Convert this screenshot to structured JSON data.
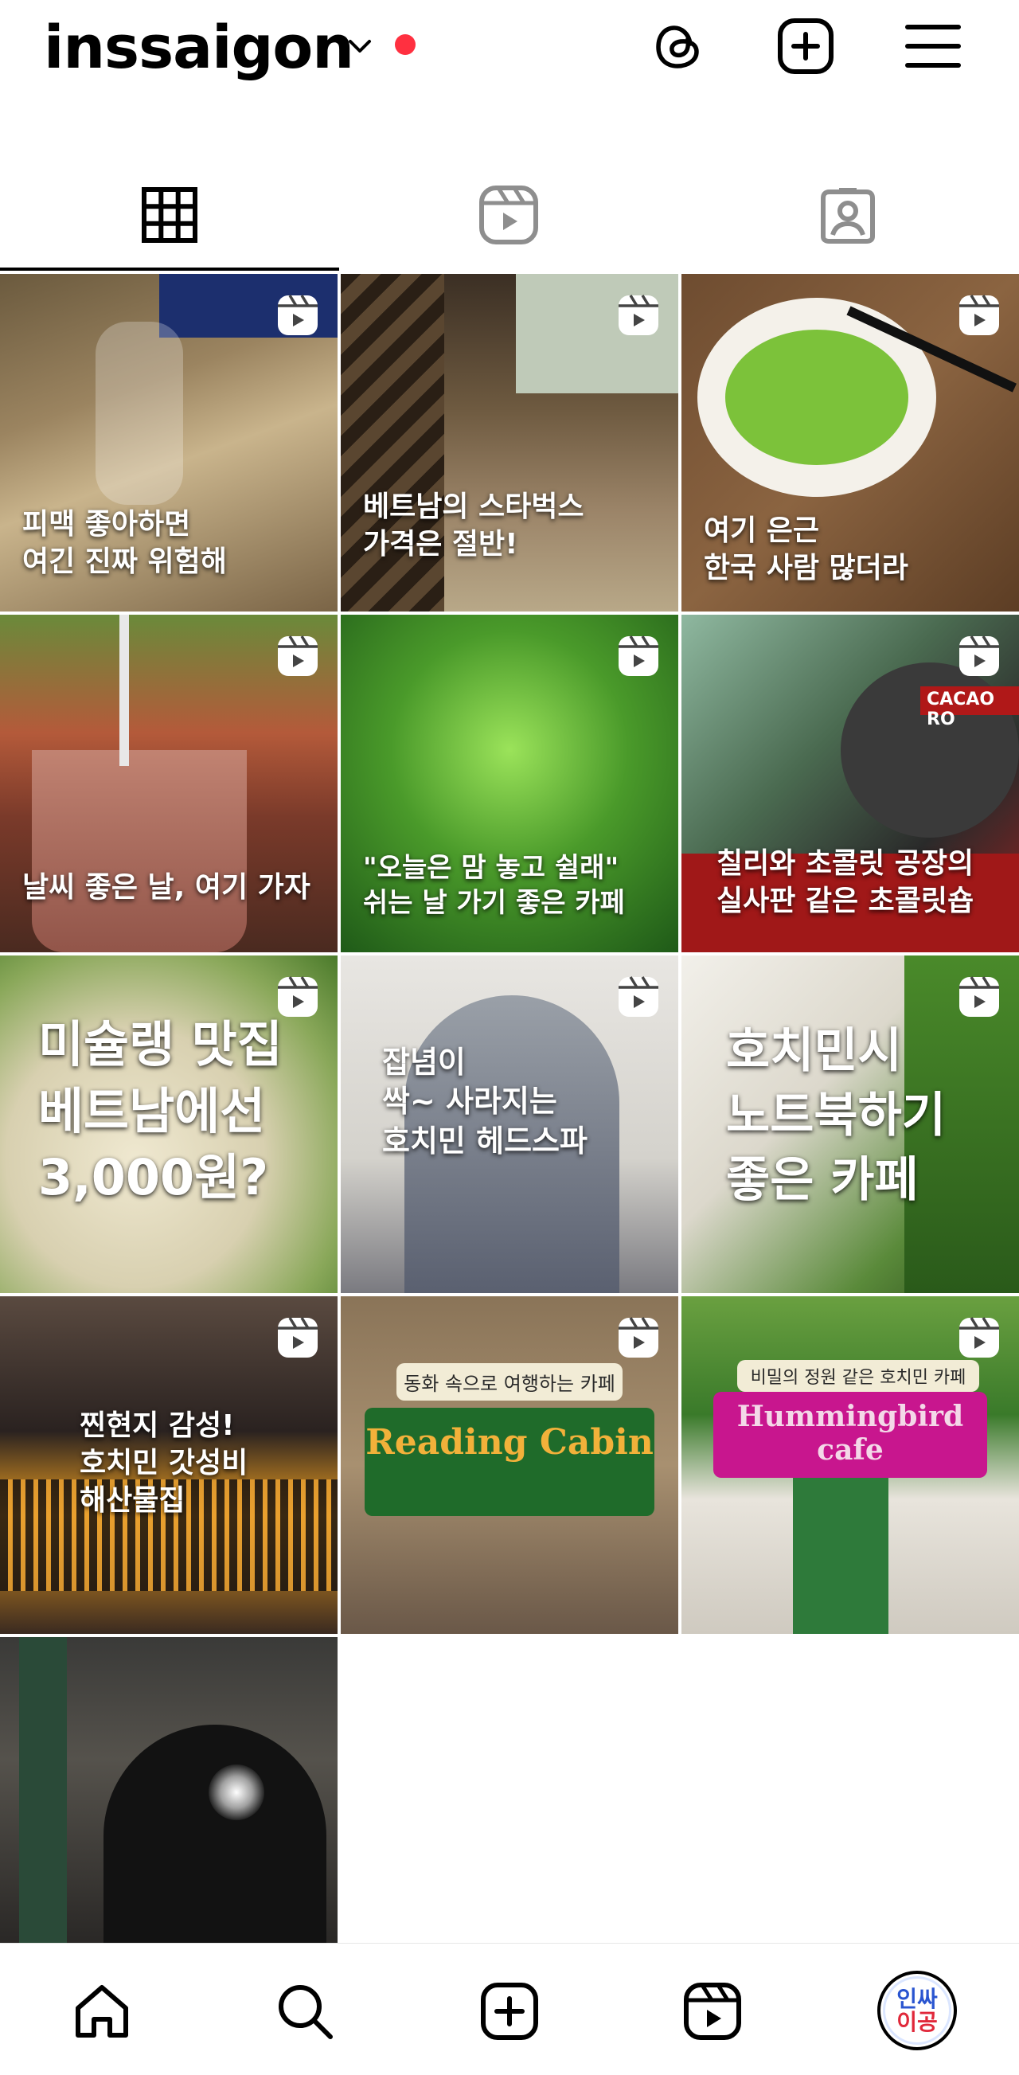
{
  "header": {
    "username": "inssaigon",
    "icons": [
      "chevron-down-icon",
      "threads-icon",
      "add-post-icon",
      "menu-icon"
    ],
    "notification_dot_color": "#ff3040"
  },
  "tabs": [
    {
      "name": "posts-grid",
      "icon": "grid-icon",
      "active": true
    },
    {
      "name": "reels",
      "icon": "reels-icon",
      "active": false
    },
    {
      "name": "tagged",
      "icon": "tagged-icon",
      "active": false
    }
  ],
  "posts": [
    {
      "caption": "피맥 좋아하면\n여긴 진짜 위험해",
      "reel": true
    },
    {
      "caption": "베트남의 스타벅스\n가격은 절반!",
      "reel": true
    },
    {
      "caption": "여기 은근\n한국 사람 많더라",
      "reel": true
    },
    {
      "caption": "날씨 좋은 날, 여기 가자",
      "reel": true
    },
    {
      "caption": "\"오늘은 맘 놓고 쉴래\"\n쉬는 날 가기 좋은 카페",
      "reel": true
    },
    {
      "caption": "칠리와 초콜릿 공장의\n실사판 같은 초콜릿숍",
      "sign": "CACAO RO",
      "reel": true
    },
    {
      "caption": "미슐랭 맛집\n베트남에선\n3,000원?",
      "reel": true
    },
    {
      "caption": "잡념이\n싹~ 사라지는\n호치민 헤드스파",
      "reel": true
    },
    {
      "caption": "호치민시\n노트북하기\n좋은 카페",
      "reel": true
    },
    {
      "caption": "찐현지 감성!\n호치민 갓성비\n해산물집",
      "reel": true
    },
    {
      "subtitle": "동화 속으로 여행하는 카페",
      "banner": "Reading Cabin",
      "reel": true
    },
    {
      "subtitle": "비밀의 정원 같은 호치민 카페",
      "banner": "Hummingbird cafe",
      "reel": true
    },
    {
      "caption": "",
      "reel": false
    }
  ],
  "bottom_nav": {
    "items": [
      "home-icon",
      "search-icon",
      "create-icon",
      "reels-icon",
      "profile-avatar"
    ],
    "avatar_text_top": "인싸",
    "avatar_text_bottom": "이공"
  },
  "colors": {
    "accent_red": "#ff3040",
    "reading_cabin_green": "#1f6b2a",
    "reading_cabin_text": "#f2b13a",
    "hummingbird_magenta": "#c8168e"
  }
}
